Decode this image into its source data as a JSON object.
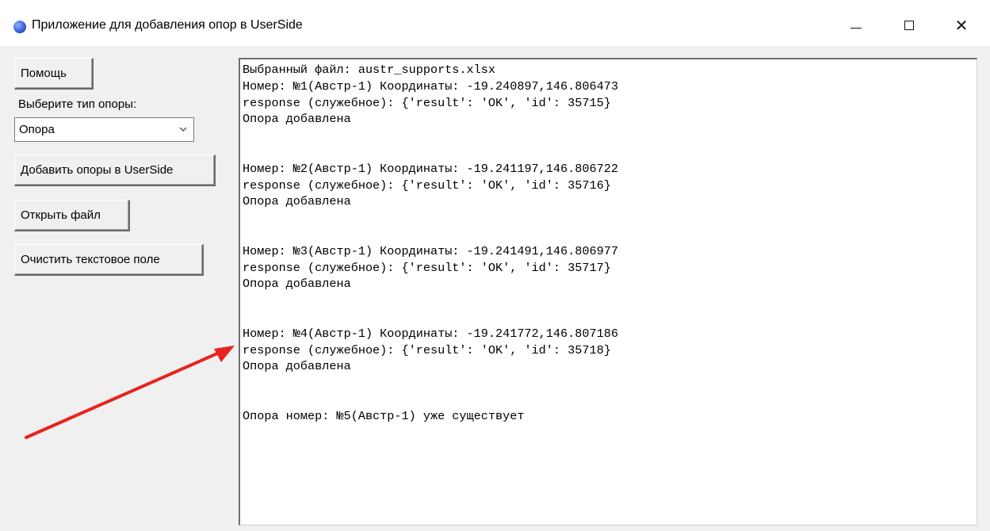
{
  "window": {
    "title": "Приложение для добавления опор в UserSide",
    "icon": "app-globe-icon",
    "controls": {
      "minimize": "minimize-icon",
      "maximize": "maximize-icon",
      "close_symbol": "✕"
    }
  },
  "sidebar": {
    "help_button": "Помощь",
    "type_label": "Выберите тип опоры:",
    "type_select": {
      "value": "Опора"
    },
    "add_button": "Добавить опоры в UserSide",
    "open_button": "Открыть файл",
    "clear_button": "Очистить текстовое поле"
  },
  "output": {
    "lines": [
      "Выбранный файл: austr_supports.xlsx",
      "Номер: №1(Австр-1) Координаты: -19.240897,146.806473",
      "response (служебное): {'result': 'OK', 'id': 35715}",
      "Опора добавлена",
      "",
      "",
      "Номер: №2(Австр-1) Координаты: -19.241197,146.806722",
      "response (служебное): {'result': 'OK', 'id': 35716}",
      "Опора добавлена",
      "",
      "",
      "Номер: №3(Австр-1) Координаты: -19.241491,146.806977",
      "response (служебное): {'result': 'OK', 'id': 35717}",
      "Опора добавлена",
      "",
      "",
      "Номер: №4(Австр-1) Координаты: -19.241772,146.807186",
      "response (служебное): {'result': 'OK', 'id': 35718}",
      "Опора добавлена",
      "",
      "",
      "Опора номер: №5(Австр-1) уже существует"
    ]
  },
  "annotation": {
    "arrow_color": "#e8231c",
    "icon": "red-arrow-annotation"
  },
  "colors": {
    "window_bg": "#f0f0f0",
    "titlebar_bg": "#ffffff",
    "text_area_bg": "#ffffff"
  }
}
